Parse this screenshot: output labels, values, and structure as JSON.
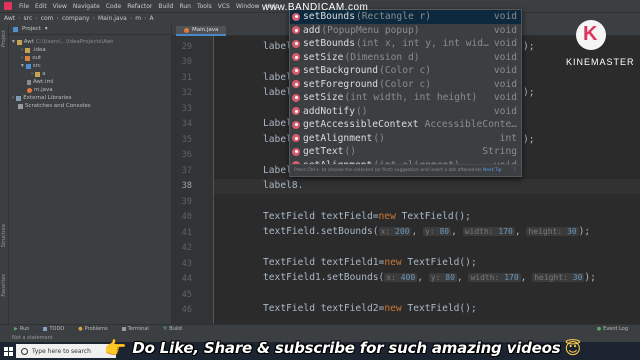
{
  "menubar": {
    "items": [
      "File",
      "Edit",
      "View",
      "Navigate",
      "Code",
      "Refactor",
      "Build",
      "Run",
      "Tools",
      "VCS",
      "Window",
      "Help"
    ]
  },
  "breadcrumb": [
    "Awt",
    "src",
    "com",
    "company",
    "Main.java",
    "m",
    "A"
  ],
  "project": {
    "header": "Project",
    "tree": [
      {
        "label": "Awt",
        "suffix": "C:\\Users\\...\\IdeaProjects\\Awt",
        "icon": "folder-icon",
        "depth": 0
      },
      {
        "label": ".idea",
        "icon": "folder-icon",
        "depth": 1
      },
      {
        "label": "out",
        "icon": "folder-icon",
        "depth": 1
      },
      {
        "label": "src",
        "icon": "folder-icon",
        "depth": 1
      },
      {
        "label": "a",
        "icon": "package-icon",
        "depth": 2
      },
      {
        "label": "Awt.iml",
        "icon": "file-icon",
        "depth": 1
      },
      {
        "label": "m.java",
        "icon": "java-file-icon",
        "depth": 1
      },
      {
        "label": "External Libraries",
        "icon": "library-icon",
        "depth": 0
      },
      {
        "label": "Scratches and Consoles",
        "icon": "scratch-icon",
        "depth": 0
      }
    ],
    "side_tabs": [
      "Project",
      "Structure",
      "Favorites"
    ]
  },
  "editor": {
    "tab_label": "Main.java",
    "line_numbers": [
      29,
      30,
      31,
      32,
      33,
      34,
      35,
      36,
      37,
      38,
      39,
      40,
      41,
      42,
      43,
      44,
      45,
      46
    ],
    "current_line": 38,
    "visible_fragments": {
      "l29": "label",
      "l29_tail": ");",
      "l31": "label",
      "l32": "label",
      "l32_tail": ");",
      "l34": "Label",
      "l35": "label",
      "l35_tail": ");",
      "l37": "Label",
      "l38": "label8."
    },
    "lines": {
      "l40": {
        "type": "TextField",
        "var": "textField",
        "kw": "new",
        "ctor": "TextField();"
      },
      "l41": {
        "call": "textField.setBounds(",
        "args": [
          {
            "name": "x:",
            "val": "200"
          },
          {
            "name": "y:",
            "val": "80"
          },
          {
            "name": "width:",
            "val": "170"
          },
          {
            "name": "height:",
            "val": "30"
          }
        ],
        "end": ");"
      },
      "l43": {
        "type": "TextField",
        "var": "textField1",
        "kw": "new",
        "ctor": "TextField();"
      },
      "l44": {
        "call": "textField1.setBounds(",
        "args": [
          {
            "name": "x:",
            "val": "400"
          },
          {
            "name": "y:",
            "val": "80"
          },
          {
            "name": "width:",
            "val": "170"
          },
          {
            "name": "height:",
            "val": "30"
          }
        ],
        "end": ");"
      },
      "l46": {
        "type": "TextField",
        "var": "textField2",
        "kw": "new",
        "ctor": "TextField();"
      }
    }
  },
  "completion": {
    "items": [
      {
        "name": "setBounds",
        "params": "(Rectangle r)",
        "rtype": "void"
      },
      {
        "name": "add",
        "params": "(PopupMenu popup)",
        "rtype": "void"
      },
      {
        "name": "setBounds",
        "params": "(int x, int y, int wid…",
        "rtype": "void"
      },
      {
        "name": "setSize",
        "params": "(Dimension d)",
        "rtype": "void"
      },
      {
        "name": "setBackground",
        "params": "(Color c)",
        "rtype": "void"
      },
      {
        "name": "setForeground",
        "params": "(Color c)",
        "rtype": "void"
      },
      {
        "name": "setSize",
        "params": "(int width, int height)",
        "rtype": "void"
      },
      {
        "name": "addNotify",
        "params": "()",
        "rtype": "void"
      },
      {
        "name": "getAccessibleContext",
        "params": "",
        "rtype": "AccessibleConte…"
      },
      {
        "name": "getAlignment",
        "params": "()",
        "rtype": "int"
      },
      {
        "name": "getText",
        "params": "()",
        "rtype": "String"
      },
      {
        "name": "setAlignment",
        "params": "(int alignment)",
        "rtype": "void"
      }
    ],
    "footer_text": "Press Ctrl+. to choose the selected (or first) suggestion and insert a dot afterwards",
    "footer_link": "Next Tip"
  },
  "bottom_toolbar": {
    "items": [
      "Run",
      "TODO",
      "Problems",
      "Terminal",
      "Build"
    ],
    "event_log": "Event Log"
  },
  "status_text": "Not a statement",
  "taskbar": {
    "search_placeholder": "Type here to search"
  },
  "overlay": {
    "promo_text": "Do Like, Share  & subscribe for such amazing videos",
    "bandicam": "www.BANDICAM.com",
    "kinemaster": "KINEMASTER"
  },
  "colors": {
    "ide_bg": "#2b2b2b",
    "panel_bg": "#3c3f41",
    "keyword": "#cc7832",
    "number": "#6897bb",
    "method_icon": "#d65b6e",
    "taskbar": "#1b2430"
  }
}
